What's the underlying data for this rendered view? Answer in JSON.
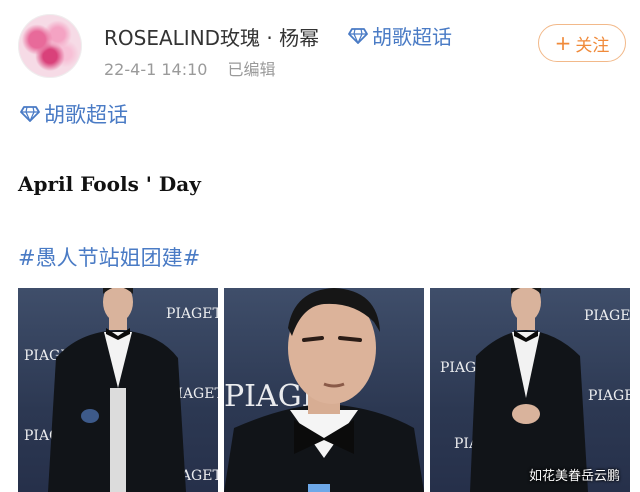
{
  "post": {
    "username": "ROSEALIND玫瑰 · 杨幂",
    "super_topic_chip": "胡歌超话",
    "timestamp": "22-4-1 14:10",
    "edited": "已编辑",
    "follow_label": "关注",
    "topic_line": "胡歌超话",
    "title": "April Fools ' Day",
    "hashtag": "#愚人节站姐团建#"
  },
  "photos": {
    "logo_text": "PIAGET",
    "watermark": "如花美眷岳云鹏"
  },
  "colors": {
    "link_blue": "#4a7bc5",
    "follow_orange": "#f08a3a",
    "meta_gray": "#9a9a9a",
    "photo_backdrop": "#2c3852"
  },
  "icons": [
    "diamond-icon",
    "plus-icon"
  ]
}
